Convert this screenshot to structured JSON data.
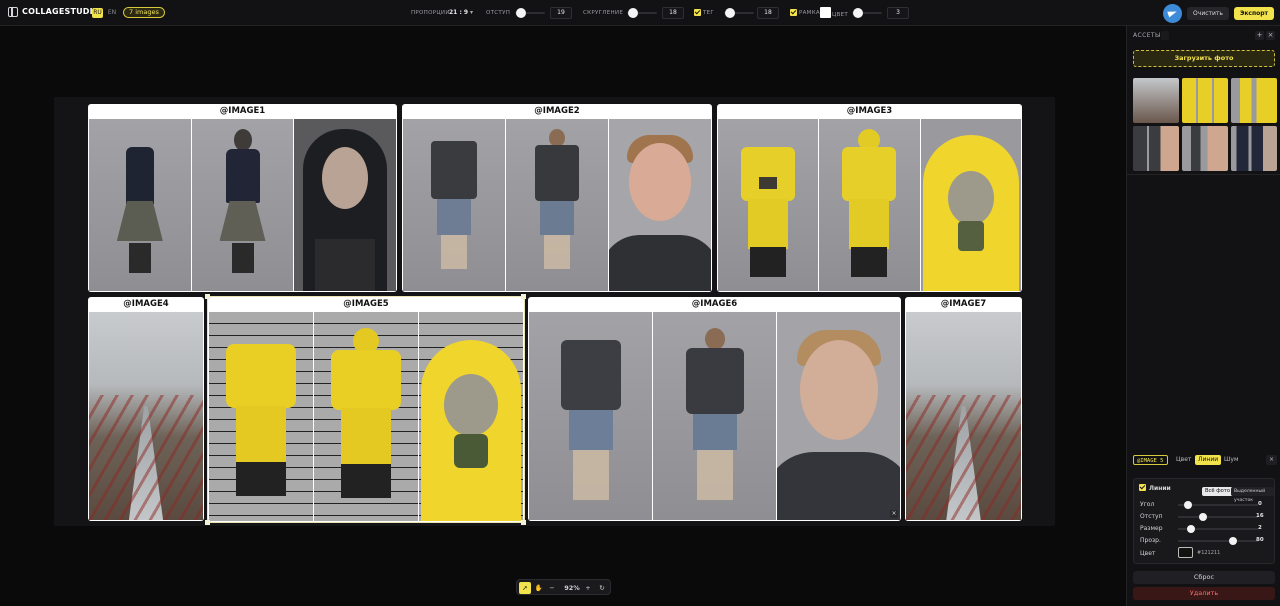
{
  "header": {
    "brand": "COLLAGESTUDIO",
    "lang_ru": "RU",
    "lang_en": "EN",
    "images_badge": "7 images",
    "proportions_label": "ПРОПОРЦИИ",
    "proportions_value": "21 : 9",
    "padding_label": "ОТСТУП",
    "padding_value": "19",
    "rounding_label": "СКРУГЛЕНИЕ",
    "rounding_value": "18",
    "tag_label": "ТЕГ",
    "tag_value": "18",
    "frame_label": "РАМКА",
    "frame_sub_label": "ЦВЕТ",
    "frame_value": "3",
    "clear_label": "Очистить",
    "export_label": "Экспорт"
  },
  "canvas": {
    "cells": [
      {
        "title": "@IMAGE1"
      },
      {
        "title": "@IMAGE2"
      },
      {
        "title": "@IMAGE3"
      },
      {
        "title": "@IMAGE4"
      },
      {
        "title": "@IMAGE5"
      },
      {
        "title": "@IMAGE6"
      },
      {
        "title": "@IMAGE7"
      }
    ]
  },
  "zoom": {
    "minus": "−",
    "value": "92%",
    "plus": "+",
    "reset": "↻"
  },
  "sidebar": {
    "assets_title": "АССЕТЫ",
    "assets_count": "",
    "upload_label": "Загрузить фото",
    "tabs": {
      "chip": "@IMAGE 5",
      "color": "Цвет",
      "lines": "Линии",
      "noise": "Шум",
      "close": "×"
    },
    "lines_panel": {
      "title": "Линии",
      "seg_all": "Всё фото",
      "seg_selected": "Выделенный участок",
      "rows": [
        {
          "label": "Угол",
          "value": "0"
        },
        {
          "label": "Отступ",
          "value": "16"
        },
        {
          "label": "Размер",
          "value": "2"
        },
        {
          "label": "Прозр.",
          "value": "80"
        }
      ],
      "color_label": "Цвет",
      "color_value": "#121211"
    },
    "reset_label": "Сброс",
    "delete_label": "Удалить"
  },
  "colors": {
    "accent": "#f2e24c",
    "panel": "#121214",
    "danger": "#ff6b6b"
  }
}
